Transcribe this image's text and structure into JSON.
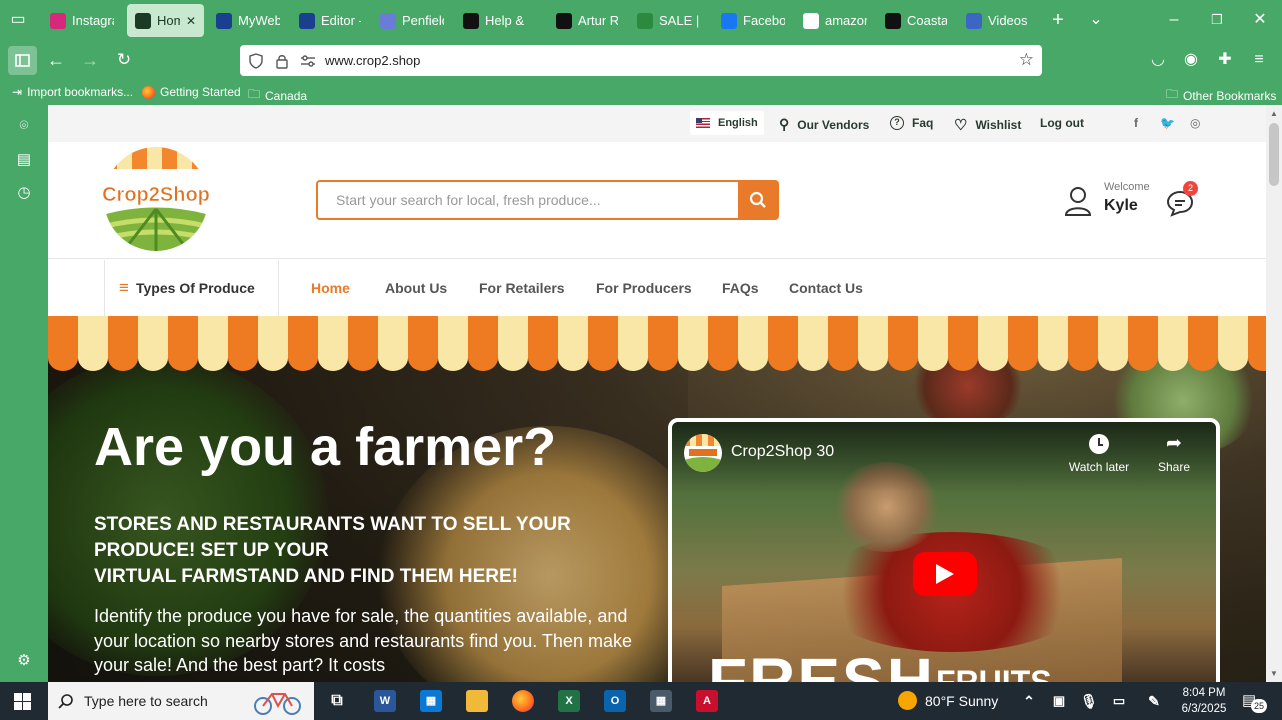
{
  "browser": {
    "tabs": [
      {
        "label": "Instagra",
        "icon": "instagram-icon",
        "color": "#d6297b"
      },
      {
        "label": "Home",
        "icon": "home-tab-icon",
        "color": "#1c3a25",
        "active": true
      },
      {
        "label": "MyWeb",
        "icon": "mywebsite-icon",
        "color": "#1a3f8f"
      },
      {
        "label": "Editor -",
        "icon": "editor-icon",
        "color": "#1a3f8f"
      },
      {
        "label": "Penfield",
        "icon": "penfield-icon",
        "color": "#6a7bd8"
      },
      {
        "label": "Help &",
        "icon": "amazon-icon",
        "color": "#111111"
      },
      {
        "label": "Artur Re",
        "icon": "x-twitter-icon",
        "color": "#111111"
      },
      {
        "label": "SALE | C",
        "icon": "sale-icon",
        "color": "#2b8a3e"
      },
      {
        "label": "Faceboo",
        "icon": "facebook-icon",
        "color": "#1877f2"
      },
      {
        "label": "amazon",
        "icon": "google-icon",
        "color": "#ffffff"
      },
      {
        "label": "Coastal",
        "icon": "coastal-icon",
        "color": "#111111"
      },
      {
        "label": "Videos |",
        "icon": "videos-icon",
        "color": "#3b66c4"
      }
    ],
    "url": "www.crop2.shop",
    "bookmarks": [
      "Import bookmarks...",
      "Getting Started",
      "Canada"
    ],
    "other_bookmarks": "Other Bookmarks"
  },
  "site": {
    "top_links": {
      "language": "English",
      "vendors": "Our Vendors",
      "faq": "Faq",
      "wishlist": "Wishlist",
      "logout": "Log out"
    },
    "logo_text": "Crop2Shop",
    "search_placeholder": "Start your search for local, fresh produce...",
    "welcome_label": "Welcome",
    "user_name": "Kyle",
    "message_count": "2",
    "produce_menu": "Types Of Produce",
    "nav": [
      "Home",
      "About Us",
      "For Retailers",
      "For Producers",
      "FAQs",
      "Contact Us"
    ]
  },
  "hero": {
    "title": "Are you a farmer?",
    "subtitle_lines": [
      "STORES AND RESTAURANTS WANT TO SELL YOUR",
      "PRODUCE! SET UP YOUR",
      "VIRTUAL FARMSTAND AND FIND THEM HERE!"
    ],
    "body": "Identify the produce you have for sale, the quantities available, and your location so nearby stores and restaurants find you. Then make your sale! And the best part? It costs",
    "video": {
      "title": "Crop2Shop 30",
      "watch_later": "Watch later",
      "share": "Share",
      "overlay_big": "FRESH",
      "overlay_small": "FRUITS"
    }
  },
  "taskbar": {
    "search_placeholder": "Type here to search",
    "weather": "80°F  Sunny",
    "time": "8:04 PM",
    "date": "6/3/2025",
    "notifications": "25"
  },
  "colors": {
    "browser_green": "#48a868",
    "accent_orange": "#e97a2a",
    "awning_cream": "#f8e7a6"
  }
}
